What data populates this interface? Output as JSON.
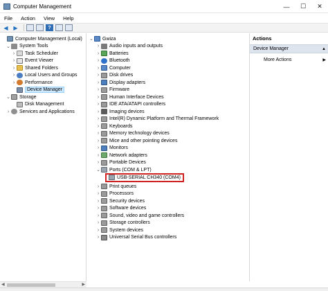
{
  "window": {
    "title": "Computer Management",
    "controls": [
      "—",
      "☐",
      "✕"
    ]
  },
  "menu": [
    "File",
    "Action",
    "View",
    "Help"
  ],
  "left_tree": [
    {
      "label": "Computer Management (Local)",
      "expander": "",
      "icon": "computer-management-icon"
    },
    {
      "label": "System Tools",
      "expander": "⌄",
      "icon": "system-tools-icon"
    },
    {
      "label": "Task Scheduler",
      "expander": "›",
      "icon": "task-scheduler-icon"
    },
    {
      "label": "Event Viewer",
      "expander": "›",
      "icon": "event-viewer-icon"
    },
    {
      "label": "Shared Folders",
      "expander": "›",
      "icon": "shared-folders-icon"
    },
    {
      "label": "Local Users and Groups",
      "expander": "›",
      "icon": "local-users-icon"
    },
    {
      "label": "Performance",
      "expander": "›",
      "icon": "performance-icon"
    },
    {
      "label": "Device Manager",
      "expander": "",
      "icon": "device-manager-icon"
    },
    {
      "label": "Storage",
      "expander": "⌄",
      "icon": "storage-icon"
    },
    {
      "label": "Disk Management",
      "expander": "",
      "icon": "disk-management-icon"
    },
    {
      "label": "Services and Applications",
      "expander": "›",
      "icon": "services-icon"
    }
  ],
  "device_tree": {
    "root": "Gwiza",
    "categories": [
      {
        "label": "Audio inputs and outputs",
        "icon": "audio-icon"
      },
      {
        "label": "Batteries",
        "icon": "battery-icon"
      },
      {
        "label": "Bluetooth",
        "icon": "bluetooth-icon"
      },
      {
        "label": "Computer",
        "icon": "computer-icon"
      },
      {
        "label": "Disk drives",
        "icon": "disk-drive-icon"
      },
      {
        "label": "Display adapters",
        "icon": "display-adapter-icon"
      },
      {
        "label": "Firmware",
        "icon": "firmware-icon"
      },
      {
        "label": "Human Interface Devices",
        "icon": "hid-icon"
      },
      {
        "label": "IDE ATA/ATAPI controllers",
        "icon": "ide-icon"
      },
      {
        "label": "Imaging devices",
        "icon": "imaging-icon"
      },
      {
        "label": "Intel(R) Dynamic Platform and Thermal Framework",
        "icon": "intel-icon"
      },
      {
        "label": "Keyboards",
        "icon": "keyboard-icon"
      },
      {
        "label": "Memory technology devices",
        "icon": "memory-icon"
      },
      {
        "label": "Mice and other pointing devices",
        "icon": "mouse-icon"
      },
      {
        "label": "Monitors",
        "icon": "monitor-icon"
      },
      {
        "label": "Network adapters",
        "icon": "network-icon"
      },
      {
        "label": "Portable Devices",
        "icon": "portable-device-icon"
      },
      {
        "label": "Ports (COM & LPT)",
        "icon": "port-icon",
        "expanded": true
      },
      {
        "label": "USB-SERIAL CH340 (COM4)",
        "icon": "serial-port-icon",
        "child": true
      },
      {
        "label": "Print queues",
        "icon": "printer-icon"
      },
      {
        "label": "Processors",
        "icon": "processor-icon"
      },
      {
        "label": "Security devices",
        "icon": "security-icon"
      },
      {
        "label": "Software devices",
        "icon": "software-device-icon"
      },
      {
        "label": "Sound, video and game controllers",
        "icon": "sound-icon"
      },
      {
        "label": "Storage controllers",
        "icon": "storage-controller-icon"
      },
      {
        "label": "System devices",
        "icon": "system-device-icon"
      },
      {
        "label": "Universal Serial Bus controllers",
        "icon": "usb-icon"
      }
    ]
  },
  "actions": {
    "header": "Actions",
    "selected": "Device Manager",
    "more": "More Actions"
  }
}
